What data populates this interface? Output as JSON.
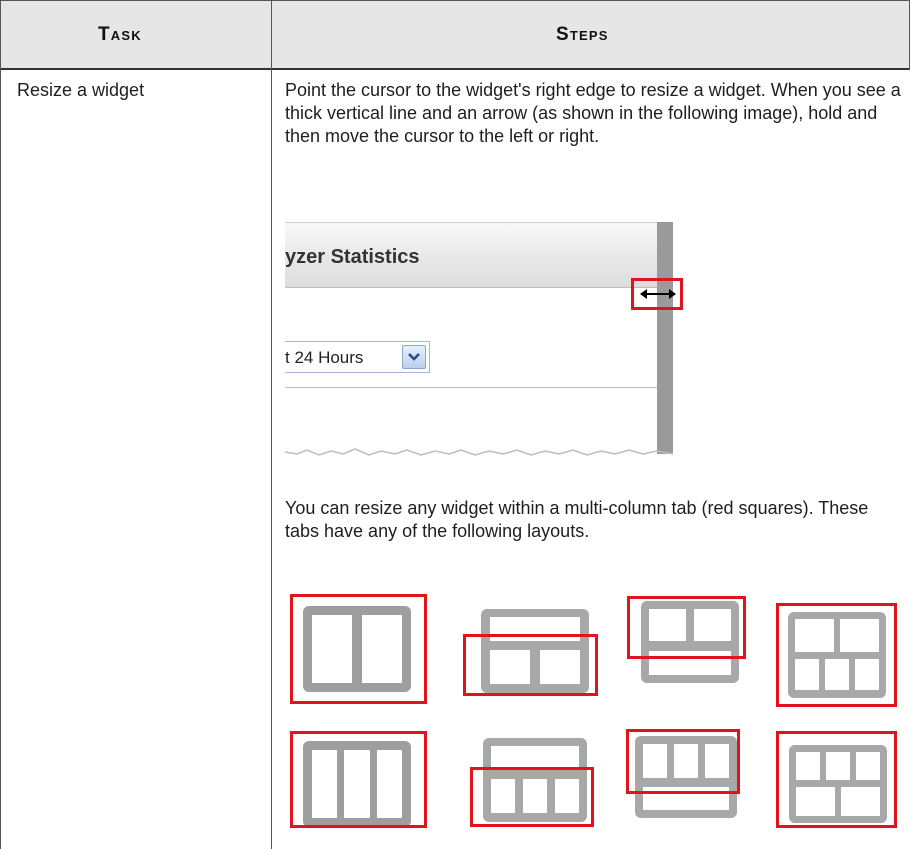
{
  "table": {
    "headers": {
      "task": "Task",
      "steps": "Steps"
    },
    "row": {
      "task": "Resize a widget",
      "steps_paragraph1": "Point the cursor to the widget's right edge to resize a widget. When you see a thick vertical line and an arrow (as shown in the following image), hold and then move the cursor to the left or right.",
      "steps_paragraph2": "You can resize any widget within a multi-column tab (red squares). These tabs have any of the following layouts."
    }
  },
  "widget_screenshot": {
    "title": "yzer Statistics",
    "select_value": "t 24 Hours",
    "select_icon": "chevron-down-icon",
    "cursor_icon": "horizontal-resize-arrow-icon"
  },
  "layouts": {
    "row1": [
      "two-columns",
      "one-row-over-two-columns",
      "two-columns-over-one-row",
      "two-over-three-columns"
    ],
    "row2": [
      "three-columns",
      "one-row-over-three-columns",
      "three-columns-over-one-row",
      "three-over-two-columns"
    ]
  },
  "colors": {
    "highlight": "#e0141c",
    "header_bg": "#e6e6e6",
    "icon_gray": "#a8a8a8"
  }
}
